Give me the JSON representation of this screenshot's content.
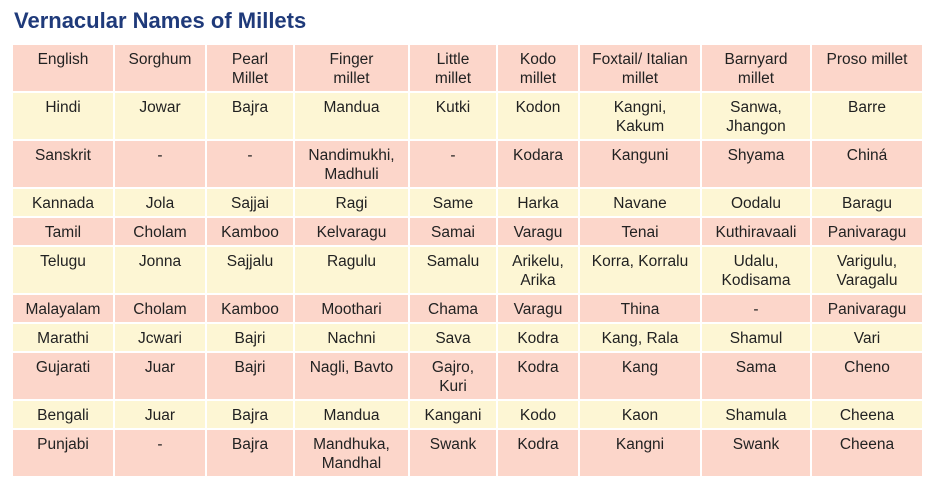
{
  "title": "Vernacular Names of Millets",
  "colors": {
    "title": "#1f3a7a",
    "row_pink": "#fcd6ca",
    "row_cream": "#fdf6d4"
  },
  "rows": [
    [
      "English",
      "Sorghum",
      "Pearl\nMillet",
      "Finger\nmillet",
      "Little\nmillet",
      "Kodo\nmillet",
      "Foxtail/ Italian\nmillet",
      "Barnyard\nmillet",
      "Proso millet"
    ],
    [
      "Hindi",
      "Jowar",
      "Bajra",
      "Mandua",
      "Kutki",
      "Kodon",
      "Kangni,\nKakum",
      "Sanwa,\nJhangon",
      "Barre"
    ],
    [
      "Sanskrit",
      "-",
      "-",
      "Nandimukhi,\nMadhuli",
      "-",
      "Kodara",
      "Kanguni",
      "Shyama",
      "Chiná"
    ],
    [
      "Kannada",
      "Jola",
      "Sajjai",
      "Ragi",
      "Same",
      "Harka",
      "Navane",
      "Oodalu",
      "Baragu"
    ],
    [
      "Tamil",
      "Cholam",
      "Kamboo",
      "Kelvaragu",
      "Samai",
      "Varagu",
      "Tenai",
      "Kuthiravaali",
      "Panivaragu"
    ],
    [
      "Telugu",
      "Jonna",
      "Sajjalu",
      "Ragulu",
      "Samalu",
      "Arikelu,\nArika",
      "Korra, Korralu",
      "Udalu,\nKodisama",
      "Varigulu,\nVaragalu"
    ],
    [
      "Malayalam",
      "Cholam",
      "Kamboo",
      "Moothari",
      "Chama",
      "Varagu",
      "Thina",
      "-",
      "Panivaragu"
    ],
    [
      "Marathi",
      "Jcwari",
      "Bajri",
      "Nachni",
      "Sava",
      "Kodra",
      "Kang, Rala",
      "Shamul",
      "Vari"
    ],
    [
      "Gujarati",
      "Juar",
      "Bajri",
      "Nagli, Bavto",
      "Gajro,\nKuri",
      "Kodra",
      "Kang",
      "Sama",
      "Cheno"
    ],
    [
      "Bengali",
      "Juar",
      "Bajra",
      "Mandua",
      "Kangani",
      "Kodo",
      "Kaon",
      "Shamula",
      "Cheena"
    ],
    [
      "Punjabi",
      "-",
      "Bajra",
      "Mandhuka,\nMandhal",
      "Swank",
      "Kodra",
      "Kangni",
      "Swank",
      "Cheena"
    ]
  ]
}
